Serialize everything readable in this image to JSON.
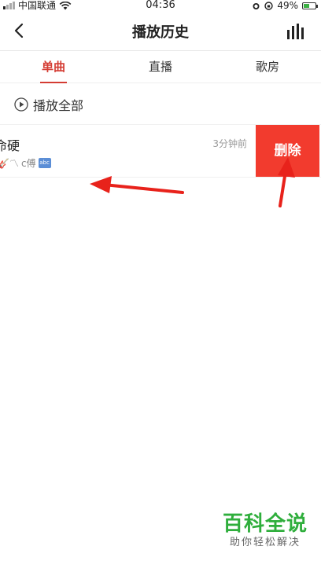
{
  "status_bar": {
    "carrier": "中国联通",
    "time": "04:36",
    "battery_percent": "49%",
    "battery_level": 0.49
  },
  "header": {
    "title": "播放历史",
    "back_icon": "back-chevron-icon",
    "right_icon": "stats-bars-icon"
  },
  "tabs": [
    {
      "label": "单曲",
      "active": true
    },
    {
      "label": "直播",
      "active": false
    },
    {
      "label": "歌房",
      "active": false
    }
  ],
  "play_all": {
    "label": "播放全部",
    "icon": "play-circle-icon"
  },
  "songs": [
    {
      "title": "命硬",
      "meta_emoji": "🎸〽",
      "meta_text": "c傅",
      "meta_badge": "abc",
      "time": "3分钟前",
      "delete_label": "删除"
    }
  ],
  "watermark": {
    "main": "百科全说",
    "sub": "助你轻松解决"
  },
  "colors": {
    "accent": "#d43c33",
    "delete": "#f23b2e",
    "watermark": "#2fae3c",
    "arrow": "#e8221b"
  }
}
